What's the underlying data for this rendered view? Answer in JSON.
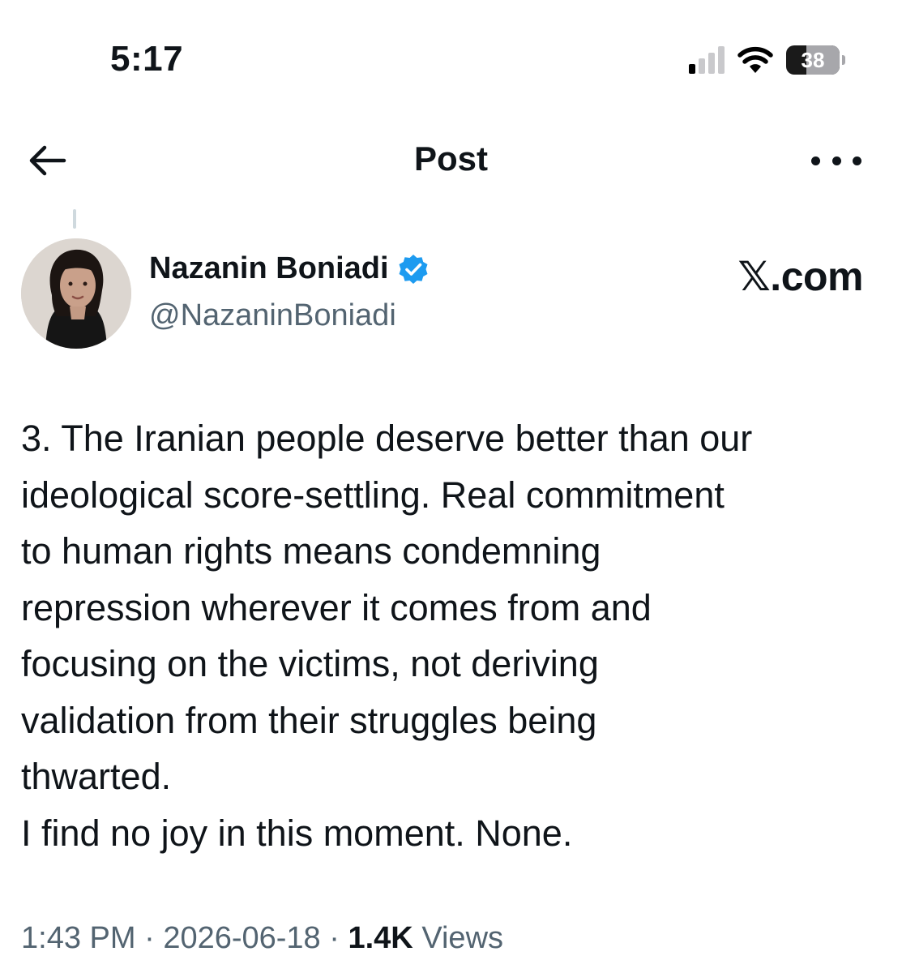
{
  "status_bar": {
    "time": "5:17",
    "battery": "38",
    "battery_level": 0.38
  },
  "header": {
    "title": "Post"
  },
  "author": {
    "display_name": "Nazanin Boniadi",
    "handle": "@NazaninBoniadi",
    "verified": true
  },
  "watermark": "𝕏.com",
  "post": {
    "text": "3. The Iranian people deserve better than our\nideological score-settling. Real commitment\nto human rights means condemning\nrepression wherever it comes from and\nfocusing on the victims, not deriving\nvalidation from their struggles being\nthwarted.\nI find no joy in this moment. None."
  },
  "meta": {
    "time": "1:43 PM",
    "separator": " · ",
    "date": "2026-06-18",
    "views_count": "1.4K",
    "views_label": "Views"
  },
  "colors": {
    "text": "#0f1419",
    "secondary": "#536471",
    "verified_badge": "#1d9bf0"
  }
}
